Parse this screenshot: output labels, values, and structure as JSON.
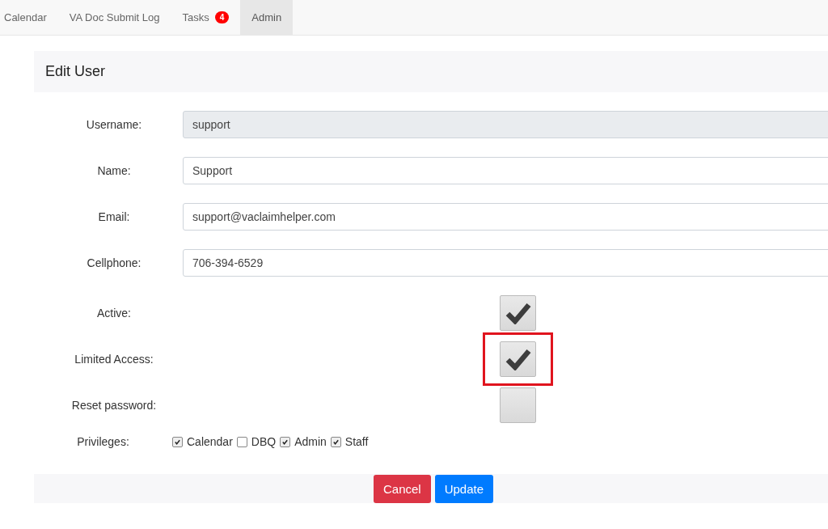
{
  "nav": {
    "tabs": [
      {
        "label": "Calendar",
        "selected": false
      },
      {
        "label": "VA Doc Submit Log",
        "selected": false
      },
      {
        "label": "Tasks",
        "selected": false,
        "badge": "4"
      },
      {
        "label": "Admin",
        "selected": true
      }
    ]
  },
  "form": {
    "title": "Edit User",
    "fields": [
      {
        "label": "Username:",
        "value": "support",
        "disabled": true
      },
      {
        "label": "Name:",
        "value": "Support",
        "disabled": false
      },
      {
        "label": "Email:",
        "value": "support@vaclaimhelper.com",
        "disabled": false
      },
      {
        "label": "Cellphone:",
        "value": "706-394-6529",
        "disabled": false
      }
    ],
    "toggles": [
      {
        "label": "Active:",
        "checked": true,
        "highlighted": false
      },
      {
        "label": "Limited Access:",
        "checked": true,
        "highlighted": true
      },
      {
        "label": "Reset password:",
        "checked": false,
        "highlighted": false
      }
    ],
    "privileges": {
      "label": "Privileges:",
      "options": [
        {
          "label": "Calendar",
          "checked": true
        },
        {
          "label": "DBQ",
          "checked": false
        },
        {
          "label": "Admin",
          "checked": true
        },
        {
          "label": "Staff",
          "checked": true
        }
      ]
    },
    "buttons": [
      {
        "label": "Cancel",
        "kind": "danger"
      },
      {
        "label": "Update",
        "kind": "primary"
      }
    ]
  }
}
